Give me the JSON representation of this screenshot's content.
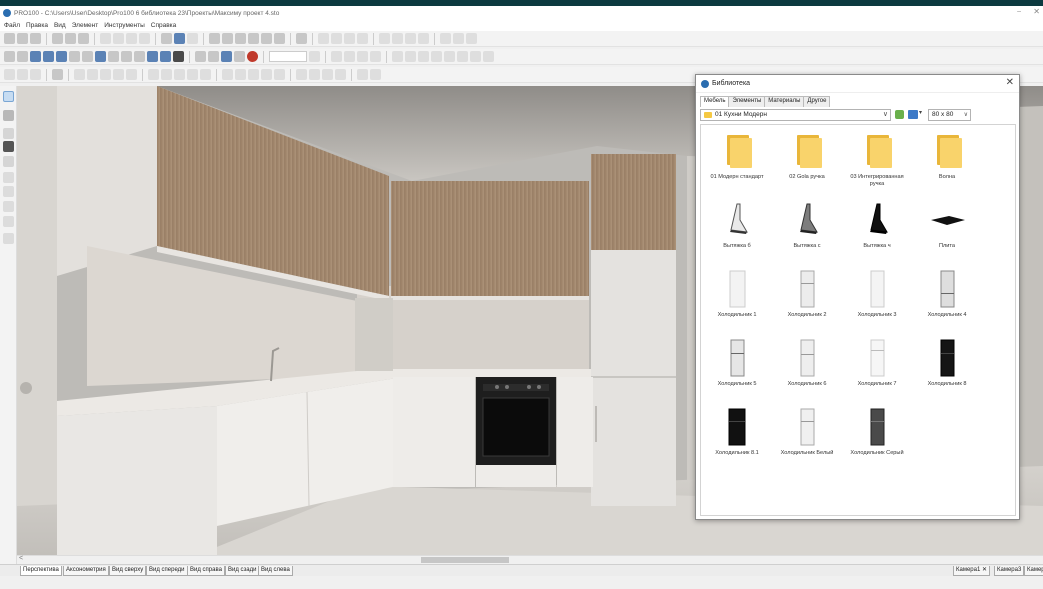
{
  "window": {
    "title": "PRO100 - C:\\Users\\User\\Desktop\\Pro100 6 библиотека 23\\Проекты\\Максиму проект 4.sto",
    "min_label": "–",
    "close_label": "✕"
  },
  "menu": [
    "Файл",
    "Правка",
    "Вид",
    "Элемент",
    "Инструменты",
    "Справка"
  ],
  "library": {
    "title": "Библиотека",
    "close_label": "✕",
    "tabs": [
      "Мебель",
      "Элементы",
      "Материалы",
      "Другое"
    ],
    "active_tab": "Мебель",
    "path": "01 Кухни Модерн",
    "path_arrow": "∨",
    "view_arrow": "▾",
    "thumb_size": "80 x 80",
    "thumb_size_arrow": "∨",
    "items": [
      {
        "label": "01 Модерн стандарт",
        "icon": "folder-icon"
      },
      {
        "label": "02 Gola ручка",
        "icon": "folder-icon"
      },
      {
        "label": "03 Интегрированная ручка",
        "icon": "folder-icon"
      },
      {
        "label": "Волна",
        "icon": "folder-icon"
      },
      {
        "label": "Вытяжка б",
        "icon": "hood-icon"
      },
      {
        "label": "Вытяжка с",
        "icon": "hood-icon"
      },
      {
        "label": "Вытяжка ч",
        "icon": "hood-icon"
      },
      {
        "label": "Плита",
        "icon": "hob-icon"
      },
      {
        "label": "Холодильник 1",
        "icon": "fridge-icon"
      },
      {
        "label": "Холодильник 2",
        "icon": "fridge-icon"
      },
      {
        "label": "Холодильник 3",
        "icon": "fridge-icon"
      },
      {
        "label": "Холодильник 4",
        "icon": "fridge-icon"
      },
      {
        "label": "Холодильник 5",
        "icon": "fridge-icon"
      },
      {
        "label": "Холодильник 6",
        "icon": "fridge-icon"
      },
      {
        "label": "Холодильник 7",
        "icon": "fridge-icon"
      },
      {
        "label": "Холодильник 8",
        "icon": "fridge-icon"
      },
      {
        "label": "Холодильник 8.1",
        "icon": "fridge-icon"
      },
      {
        "label": "Холодильник Белый",
        "icon": "fridge-icon"
      },
      {
        "label": "Холодильник Серый",
        "icon": "fridge-icon"
      }
    ]
  },
  "view_tabs": [
    "Перспектива",
    "Аксонометрия",
    "Вид сверху",
    "Вид спереди",
    "Вид справа",
    "Вид сзади",
    "Вид слева"
  ],
  "active_view_tab": "Перспектива",
  "camera_tabs": [
    "Камера1",
    "Камера3",
    "Камер"
  ],
  "camera_close": "✕",
  "scroll_left_arrow": "<",
  "colors": {
    "title_bar": "#0c3a40",
    "cabinet_wood": "#a68a6e",
    "folder": "#f5c842",
    "accent": "#2a6db0"
  }
}
